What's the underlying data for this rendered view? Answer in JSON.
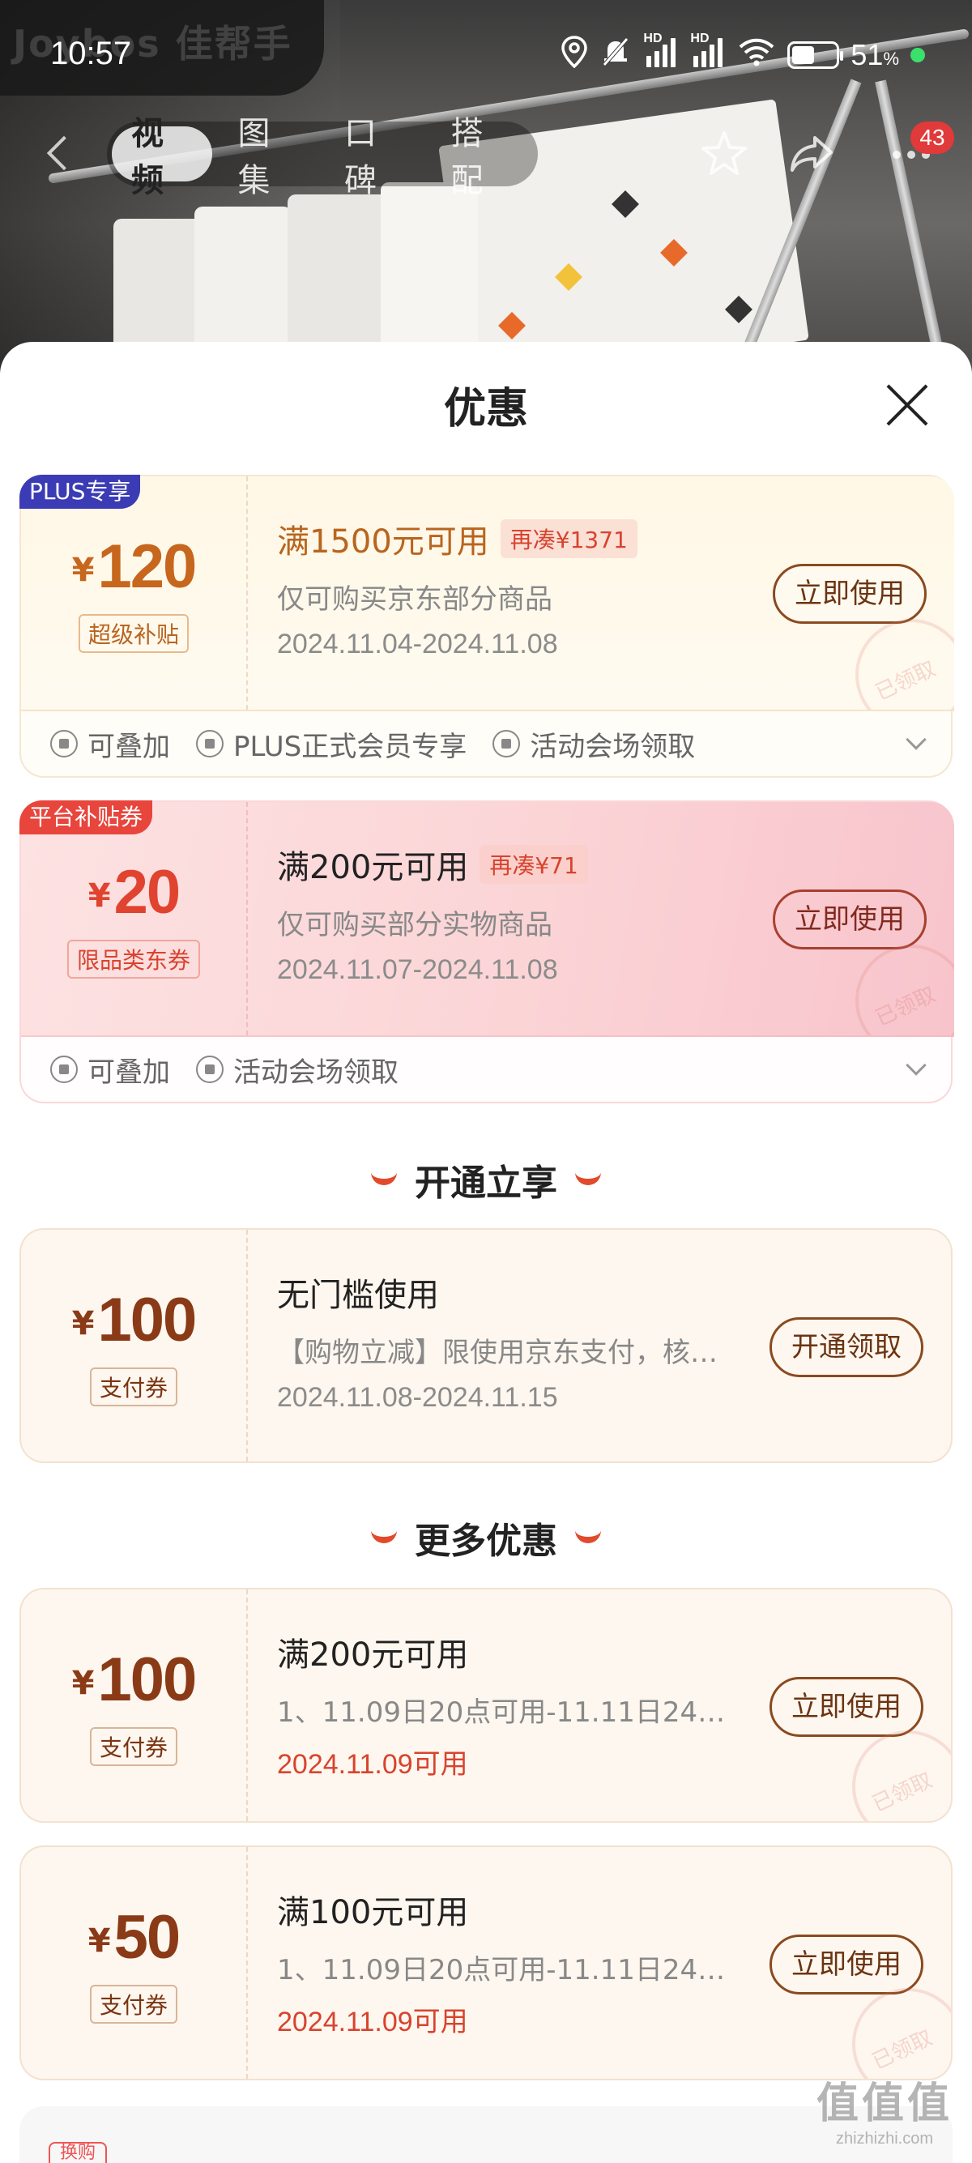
{
  "status_bar": {
    "time": "10:57",
    "hd1": "HD",
    "hd2": "HD",
    "battery_percent": "51",
    "battery_unit": "%",
    "battery_level": 0.51
  },
  "watermark": {
    "brand": "Joybos 佳帮手"
  },
  "nav": {
    "tabs": [
      {
        "label": "视频",
        "active": true
      },
      {
        "label": "图集",
        "active": false
      },
      {
        "label": "口碑",
        "active": false
      },
      {
        "label": "搭配",
        "active": false
      }
    ],
    "badge": "43"
  },
  "sheet": {
    "title": "优惠"
  },
  "coupons": [
    {
      "tag": "PLUS专享",
      "currency": "¥",
      "amount": "120",
      "kind": "超级补贴",
      "title": "满1500元可用",
      "extra": "再凑¥1371",
      "desc": "仅可购买京东部分商品",
      "date": "2024.11.04-2024.11.08",
      "button": "立即使用",
      "stamp": "已领取",
      "footer": [
        "可叠加",
        "PLUS正式会员专享",
        "活动会场领取"
      ]
    },
    {
      "tag": "平台补贴券",
      "currency": "¥",
      "amount": "20",
      "kind": "限品类东券",
      "title": "满200元可用",
      "extra": "再凑¥71",
      "desc": "仅可购买部分实物商品",
      "date": "2024.11.07-2024.11.08",
      "button": "立即使用",
      "stamp": "已领取",
      "footer": [
        "可叠加",
        "活动会场领取"
      ]
    }
  ],
  "section_open": {
    "title": "开通立享"
  },
  "open_coupon": {
    "currency": "¥",
    "amount": "100",
    "kind": "支付券",
    "title": "无门槛使用",
    "desc": "【购物立减】限使用京东支付，核…",
    "date": "2024.11.08-2024.11.15",
    "button": "开通领取"
  },
  "section_more": {
    "title": "更多优惠"
  },
  "more_coupons": [
    {
      "currency": "¥",
      "amount": "100",
      "kind": "支付券",
      "title": "满200元可用",
      "desc": "1、11.09日20点可用-11.11日24点…",
      "date": "2024.11.09可用",
      "button": "立即使用",
      "stamp": "已领取"
    },
    {
      "currency": "¥",
      "amount": "50",
      "kind": "支付券",
      "title": "满100元可用",
      "desc": "1、11.09日20点可用-11.11日24点…",
      "date": "2024.11.09可用",
      "button": "立即使用",
      "stamp": "已领取"
    }
  ],
  "partial_tag": "换购",
  "site_watermark": {
    "big": "值值值",
    "small": "zhizhizhi.com"
  },
  "colors": {
    "accent_red": "#e24a2c",
    "gold_text": "#b8651f",
    "plus_tag": "#3b3bb5",
    "pink_tag": "#e8453c"
  }
}
